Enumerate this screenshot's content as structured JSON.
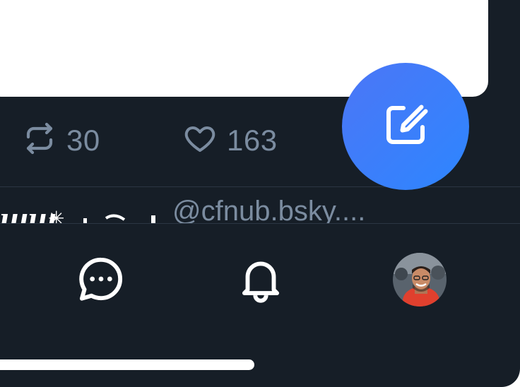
{
  "post_actions": {
    "repost_count": "30",
    "like_count": "163"
  },
  "next_post": {
    "handle_text": "@cfnub.bsky...."
  },
  "fab": {
    "icon": "compose-icon",
    "color": "#3a7ffa"
  },
  "bottom_nav": {
    "items": [
      {
        "icon": "chat-icon"
      },
      {
        "icon": "bell-icon"
      },
      {
        "icon": "avatar"
      }
    ]
  },
  "colors": {
    "background": "#161e27",
    "muted": "#7b8ca0",
    "divider": "#2b3643"
  }
}
